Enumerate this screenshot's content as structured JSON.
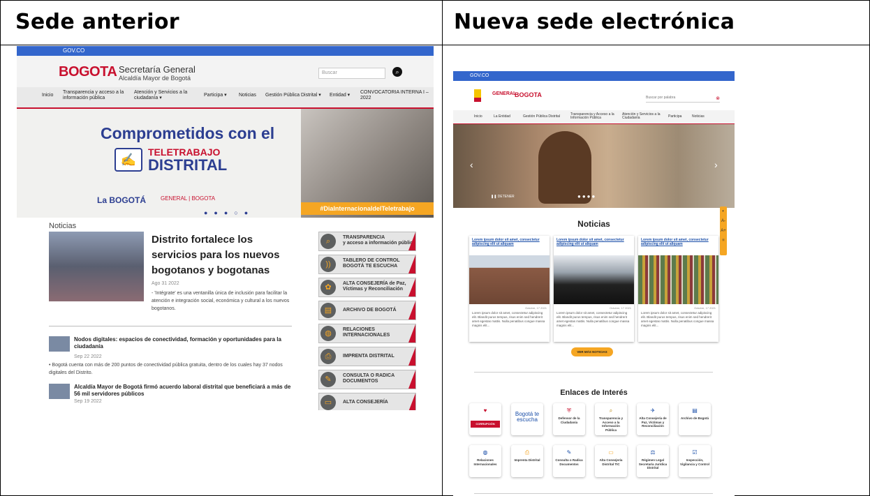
{
  "columns": {
    "left_title": "Sede anterior",
    "right_title": "Nueva sede electrónica"
  },
  "old_site": {
    "gov_bar": "GOV.CO",
    "logo": "BOGOTA",
    "title": "Secretaría General",
    "subtitle": "Alcaldía Mayor de Bogotá",
    "search_placeholder": "Buscar",
    "nav": [
      "Inicio",
      "Transparencia y acceso a la información pública",
      "Atención y Servicios a la ciudadanía ▾",
      "Participa ▾",
      "Noticias",
      "Gestión Pública Distrital ▾",
      "Entidad ▾",
      "CONVOCATORIA INTERNA I – 2022"
    ],
    "hero": {
      "line1": "Comprometidos con el",
      "line2": "TELETRABAJO",
      "line3": "DISTRITAL",
      "brand": "La BOGOTÁ",
      "logos": "GENERAL | BOGOTA",
      "hashtag": "#DiaInternacionaldelTeletrabajo"
    },
    "news_label": "Noticias",
    "featured": {
      "title": "Distrito fortalece los servicios para los nuevos bogotanos y bogotanas",
      "date": "Ago 31 2022",
      "desc": "- 'Intégrate' es una ventanilla única de inclusión para facilitar la atención e integración social, económica y cultural a los nuevos bogotanos."
    },
    "items": [
      {
        "title": "Nodos digitales: espacios de conectividad, formación y oportunidades para la ciudadanía",
        "date": "Sep 22 2022",
        "desc": "• Bogotá cuenta con más de 200 puntos de conectividad pública gratuita, dentro de los cuales hay 37 nodos digitales del Distrito."
      },
      {
        "title": "Alcaldía Mayor de Bogotá firmó acuerdo laboral distrital que beneficiará a más de 56 mil servidores públicos",
        "date": "Sep 19 2022"
      }
    ],
    "sidebar": [
      {
        "label": "TRANSPARENCIA",
        "sub": "y acceso a información pública"
      },
      {
        "label": "TABLERO DE CONTROL",
        "sub": "BOGOTÁ TE ESCUCHA"
      },
      {
        "label": "ALTA CONSEJERÍA de Paz,",
        "sub": "Víctimas y Reconciliación"
      },
      {
        "label": "ARCHIVO DE BOGOTÁ",
        "sub": ""
      },
      {
        "label": "RELACIONES",
        "sub": "INTERNACIONALES"
      },
      {
        "label": "IMPRENTA DISTRITAL",
        "sub": ""
      },
      {
        "label": "CONSULTA O RADICA",
        "sub": "DOCUMENTOS"
      },
      {
        "label": "ALTA CONSEJERÍA",
        "sub": ""
      }
    ]
  },
  "new_site": {
    "gov_bar": "GOV.CO",
    "logo_general": "GENERAL",
    "logo_bogota": "BOGOTA",
    "search_placeholder": "Buscar por palabra",
    "nav": [
      "Inicio",
      "La Entidad",
      "Gestión Pública Distrital",
      "Transparencia y Acceso a la Información Pública",
      "Atención y Servicios a la Ciudadanía",
      "Participa",
      "Noticias"
    ],
    "slider_pause": "DETENER",
    "news_heading": "Noticias",
    "cards": [
      {
        "title": "Lorem ipsum dolor sit amet, consectetur adipiscing elit ut aliquam",
        "date": "Octubre, 17 2021",
        "text": "Lorem ipsum dolor sit amet, consectetur adipiscing elit. Blandit purus tempus, risus enim sed hendrerit amet egestas mattis. Nulla penatibus congue massa magnis elit..."
      },
      {
        "title": "Lorem ipsum dolor sit amet, consectetur adipiscing elit ut aliquam",
        "date": "Octubre, 17 2021",
        "text": "Lorem ipsum dolor sit amet, consectetur adipiscing elit. Blandit purus tempus, risus enim sed hendrerit amet egestas mattis. Nulla penatibus congue massa magnis elit..."
      },
      {
        "title": "Lorem ipsum dolor sit amet, consectetur adipiscing elit ut aliquam",
        "date": "Octubre, 17 2021",
        "text": "Lorem ipsum dolor sit amet, consectetur adipiscing elit. Blandit purus tempus, risus enim sed hendrerit amet egestas mattis. Nulla penatibus congue massa magnis elit..."
      }
    ],
    "more_news": "VER MÁS NOTICIAS",
    "links_heading": "Enlaces de Interés",
    "links": [
      {
        "label": "CORRUPCIÓN",
        "icon": "shield-icon"
      },
      {
        "label": "Bogotá te escucha",
        "icon": "speech-icon"
      },
      {
        "label": "Defensor de la Ciudadanía",
        "icon": "shield-icon"
      },
      {
        "label": "Transparencia y Acceso a la Información Pública",
        "icon": "magnifier-icon"
      },
      {
        "label": "Alta Consejería de Paz, Víctimas y Reconciliación",
        "icon": "dove-icon"
      },
      {
        "label": "Archivo de Bogotá",
        "icon": "folder-icon"
      },
      {
        "label": "Relaciones Internacionales",
        "icon": "globe-icon"
      },
      {
        "label": "Imprenta Distrital",
        "icon": "printer-icon"
      },
      {
        "label": "Consulta o Radica Documentos",
        "icon": "document-icon"
      },
      {
        "label": "Alta Consejería Distrital TIC",
        "icon": "laptop-icon"
      },
      {
        "label": "Régimen Legal Secretaría Jurídica Distrital",
        "icon": "balance-icon"
      },
      {
        "label": "Inspección, Vigilancia y Control",
        "icon": "checklist-icon"
      }
    ]
  }
}
